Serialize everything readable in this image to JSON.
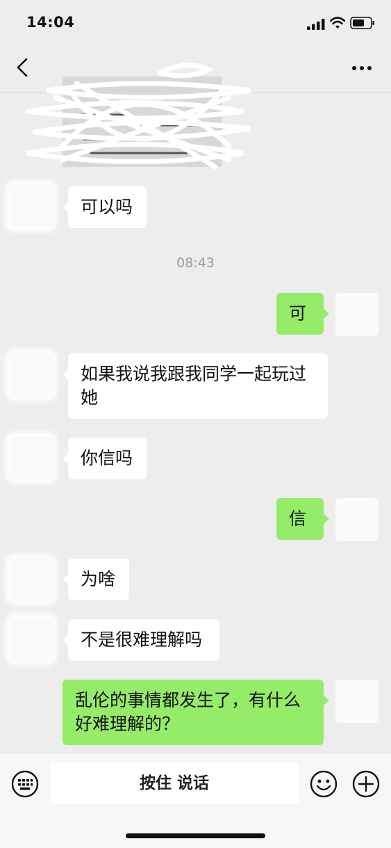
{
  "status_bar": {
    "time": "14:04"
  },
  "header": {
    "title_redacted": true
  },
  "messages": [
    {
      "side": "left",
      "text": "可以吗"
    },
    {
      "side": "timestamp",
      "text": "08:43"
    },
    {
      "side": "right",
      "text": "可"
    },
    {
      "side": "left",
      "text": "如果我说我跟我同学一起玩过她"
    },
    {
      "side": "left",
      "text": "你信吗"
    },
    {
      "side": "right",
      "text": "信"
    },
    {
      "side": "left",
      "text": "为啥"
    },
    {
      "side": "left",
      "text": "不是很难理解吗"
    },
    {
      "side": "right",
      "text": "乱伦的事情都发生了，有什么好难理解的？"
    }
  ],
  "input_bar": {
    "hold_to_talk_label": "按住 说话"
  },
  "colors": {
    "background": "#ededed",
    "sent_bubble": "#95ec69",
    "received_bubble": "#ffffff",
    "timestamp": "#9a9a9a"
  },
  "icons": [
    "back-icon",
    "more-icon",
    "keyboard-icon",
    "emoji-icon",
    "plus-icon",
    "signal-icon",
    "wifi-icon",
    "battery-icon"
  ]
}
